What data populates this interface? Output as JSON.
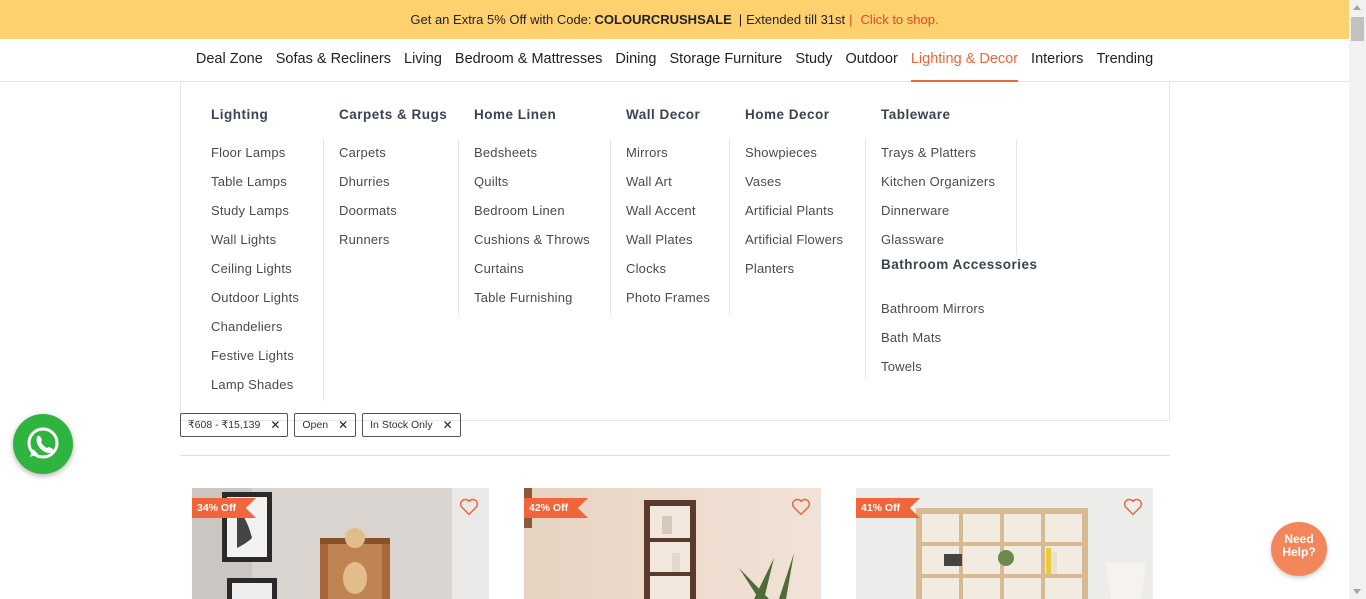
{
  "promo": {
    "prefix": "Get an Extra 5% Off with Code:",
    "code": "COLOURCRUSHSALE",
    "separator1": "|",
    "extended": "Extended till 31st",
    "separator2": "|",
    "link": "Click to shop."
  },
  "nav": {
    "items": [
      "Deal Zone",
      "Sofas & Recliners",
      "Living",
      "Bedroom & Mattresses",
      "Dining",
      "Storage Furniture",
      "Study",
      "Outdoor",
      "Lighting & Decor",
      "Interiors",
      "Trending"
    ],
    "active": "Lighting & Decor"
  },
  "mega": {
    "lighting": {
      "title": "Lighting",
      "items": [
        "Floor Lamps",
        "Table Lamps",
        "Study Lamps",
        "Wall Lights",
        "Ceiling Lights",
        "Outdoor Lights",
        "Chandeliers",
        "Festive Lights",
        "Lamp Shades"
      ]
    },
    "carpets": {
      "title": "Carpets & Rugs",
      "items": [
        "Carpets",
        "Dhurries",
        "Doormats",
        "Runners"
      ]
    },
    "linen": {
      "title": "Home Linen",
      "items": [
        "Bedsheets",
        "Quilts",
        "Bedroom Linen",
        "Cushions & Throws",
        "Curtains",
        "Table Furnishing"
      ]
    },
    "wall": {
      "title": "Wall Decor",
      "items": [
        "Mirrors",
        "Wall Art",
        "Wall Accent",
        "Wall Plates",
        "Clocks",
        "Photo Frames"
      ]
    },
    "decor": {
      "title": "Home Decor",
      "items": [
        "Showpieces",
        "Vases",
        "Artificial Plants",
        "Artificial Flowers",
        "Planters"
      ]
    },
    "tableware": {
      "title": "Tableware",
      "items": [
        "Trays & Platters",
        "Kitchen Organizers",
        "Dinnerware",
        "Glassware"
      ]
    },
    "bath": {
      "title": "Bathroom Accessories",
      "items": [
        "Bathroom Mirrors",
        "Bath Mats",
        "Towels"
      ]
    }
  },
  "filters": [
    "₹608 - ₹15,139",
    "Open",
    "In Stock Only"
  ],
  "products": [
    {
      "discount": "34% Off"
    },
    {
      "discount": "42% Off"
    },
    {
      "discount": "41% Off"
    }
  ],
  "help": {
    "line1": "Need",
    "line2": "Help?"
  },
  "colors": {
    "accent": "#f2643a",
    "promo_bg": "#fed16f",
    "whatsapp": "#2fb43f",
    "help_bg": "#f4865b"
  }
}
